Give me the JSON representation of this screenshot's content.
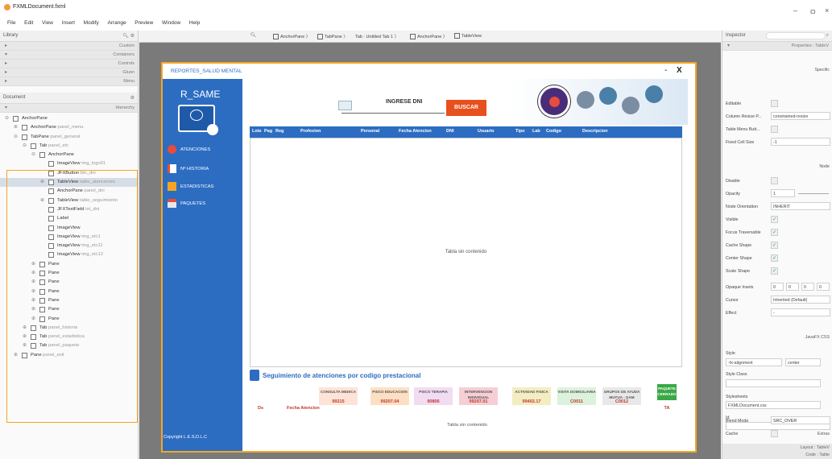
{
  "window": {
    "title": "FXMLDocument.fxml",
    "min": "–",
    "max": "ㅁ",
    "close": "×"
  },
  "menu": [
    "File",
    "Edit",
    "View",
    "Insert",
    "Modify",
    "Arrange",
    "Preview",
    "Window",
    "Help"
  ],
  "library": {
    "title": "Library",
    "sections": [
      "Custom",
      "Containers",
      "Controls",
      "Gluon",
      "Menu"
    ]
  },
  "document": {
    "title": "Document",
    "hierarchy": "Hierarchy"
  },
  "tree": [
    {
      "depth": 0,
      "tgl": "⊖",
      "name": "AnchorPane",
      "sub": ""
    },
    {
      "depth": 1,
      "tgl": "⊕",
      "name": "AnchorPane",
      "sub": "panel_menu"
    },
    {
      "depth": 1,
      "tgl": "⊖",
      "name": "TabPane",
      "sub": "panel_general"
    },
    {
      "depth": 2,
      "tgl": "⊖",
      "name": "Tab",
      "sub": "panel_etc"
    },
    {
      "depth": 3,
      "tgl": "⊖",
      "name": "AnchorPane",
      "sub": ""
    },
    {
      "depth": 4,
      "tgl": "",
      "name": "ImageView",
      "sub": "img_logo01"
    },
    {
      "depth": 4,
      "tgl": "",
      "name": "JFXButton",
      "sub": "btn_dni"
    },
    {
      "depth": 4,
      "tgl": "⊕",
      "name": "TableView",
      "sub": "table_atenciones"
    },
    {
      "depth": 4,
      "tgl": "",
      "name": "AnchorPane",
      "sub": "panel_dni"
    },
    {
      "depth": 4,
      "tgl": "⊕",
      "name": "TableView",
      "sub": "table_seguimiento"
    },
    {
      "depth": 4,
      "tgl": "",
      "name": "JFXTextField",
      "sub": "txt_dni"
    },
    {
      "depth": 4,
      "tgl": "",
      "name": "Label",
      "sub": ""
    },
    {
      "depth": 4,
      "tgl": "",
      "name": "ImageView",
      "sub": ""
    },
    {
      "depth": 4,
      "tgl": "",
      "name": "ImageView",
      "sub": "img_etc1"
    },
    {
      "depth": 4,
      "tgl": "",
      "name": "ImageView",
      "sub": "img_etc11"
    },
    {
      "depth": 4,
      "tgl": "",
      "name": "ImageView",
      "sub": "img_etc12"
    },
    {
      "depth": 3,
      "tgl": "⊕",
      "name": "Pane",
      "sub": ""
    },
    {
      "depth": 3,
      "tgl": "⊕",
      "name": "Pane",
      "sub": ""
    },
    {
      "depth": 3,
      "tgl": "⊕",
      "name": "Pane",
      "sub": ""
    },
    {
      "depth": 3,
      "tgl": "⊕",
      "name": "Pane",
      "sub": ""
    },
    {
      "depth": 3,
      "tgl": "⊕",
      "name": "Pane",
      "sub": ""
    },
    {
      "depth": 3,
      "tgl": "⊕",
      "name": "Pane",
      "sub": ""
    },
    {
      "depth": 3,
      "tgl": "⊕",
      "name": "Pane",
      "sub": ""
    },
    {
      "depth": 2,
      "tgl": "⊕",
      "name": "Tab",
      "sub": "panel_historia"
    },
    {
      "depth": 2,
      "tgl": "⊕",
      "name": "Tab",
      "sub": "panel_estadistica"
    },
    {
      "depth": 2,
      "tgl": "⊕",
      "name": "Tab",
      "sub": "panel_paquete"
    },
    {
      "depth": 1,
      "tgl": "⊕",
      "name": "Pane",
      "sub": "panel_exit"
    }
  ],
  "breadcrumb": [
    "AnchorPane",
    "TabPane",
    "Tab : Untitled Tab 1",
    "AnchorPane",
    "TableView"
  ],
  "app": {
    "title": "REPORTES_SALUD MENTAL",
    "minimize": "-",
    "close": "X",
    "brand": "R_SAME",
    "nav": [
      "ATENCIONES",
      "Nº HISTORIA",
      "ESTADISTICAS",
      "PAQUETES"
    ],
    "copyright": "Copyright L.E.S.D.L.C",
    "dni_label": "INGRESE DNI",
    "search_btn": "BUSCAR",
    "table_headers": [
      "Lote",
      "Pag",
      "Reg",
      "Profesion",
      "Personal",
      "Fecha Atencion",
      "DNI",
      "Usuario",
      "Tipo",
      "Lab",
      "Codigo",
      "Descripcion"
    ],
    "empty_table": "Tabla sin contenido",
    "seguimiento_title": "Seguimiento de atenciones por codigo prestacional",
    "seg_cols": [
      {
        "label": "CONSULTA MEDICA",
        "code": "99215",
        "bg": "#fde4d6",
        "color": "#c0392b"
      },
      {
        "label": "PSICO EDUCACION",
        "code": "99207.04",
        "bg": "#fde0c4",
        "color": "#c0392b"
      },
      {
        "label": "PSICO TERAPIA",
        "code": "90806",
        "bg": "#f1dcf2",
        "color": "#c0392b"
      },
      {
        "label": "INTERVENCION INDIVIDUAL",
        "code": "99207.01",
        "bg": "#f5cfd4",
        "color": "#c0392b"
      },
      {
        "label": "ACTIVIDAD FISICA",
        "code": "99402.17",
        "bg": "#f3edc2",
        "color": "#c0392b"
      },
      {
        "label": "VISITA DOMICILIARIA",
        "code": "C0011",
        "bg": "#dcf2dc",
        "color": "#c0392b"
      },
      {
        "label": "GRUPOS DE AYUDA MUTUA - GAM",
        "code": "C0012",
        "bg": "#e8e8e8",
        "color": "#c0392b"
      },
      {
        "label": "PAQUETE CERRADO",
        "code": "TA",
        "bg": "#3aa845",
        "color": "#c0392b"
      }
    ],
    "seg_row_labels": [
      "Ds",
      "Fecha Atencion"
    ],
    "seg_empty": "Tabla sin contenido"
  },
  "inspector": {
    "title": "Inspector",
    "properties": "Properties : TableV",
    "specific": "Specific",
    "editable": "Editable",
    "column_resize": "Column Resize P...",
    "column_resize_val": "constrained-resize",
    "menu_button": "Table Menu Butt...",
    "fixed_cell": "Fixed Cell Size",
    "fixed_cell_val": "-1",
    "node": "Node",
    "disable": "Disable",
    "opacity": "Opacity",
    "opacity_val": "1",
    "node_orientation": "Node Orientation",
    "node_orientation_val": "INHERIT",
    "visible": "Visible",
    "focus": "Focus Traversable",
    "cache_shape": "Cache Shape",
    "center_shape": "Center Shape",
    "scale_shape": "Scale Shape",
    "opaque": "Opaque Insets",
    "insets": [
      "0",
      "0",
      "0",
      "0"
    ],
    "cursor": "Cursor",
    "cursor_val": "Inherited (Default)",
    "effect": "Effect",
    "effect_val": "-",
    "javafx_css": "JavaFX CSS",
    "style": "Style",
    "style_key": "-fx-alignment",
    "style_val": "center",
    "style_class": "Style Class",
    "stylesheets": "Stylesheets",
    "stylesheet_val": "FXMLDocument.css",
    "id": "Id",
    "extras": "Extras",
    "blend": "Blend Mode",
    "blend_val": "SRC_OVER",
    "cache": "Cache",
    "layout": "Layout : TableV",
    "code": "Code : Table"
  },
  "colors": {
    "sidebar": "#2c6dc2",
    "accent": "#f4a623",
    "header": "#2c6dc2",
    "search": "#e8501d"
  }
}
